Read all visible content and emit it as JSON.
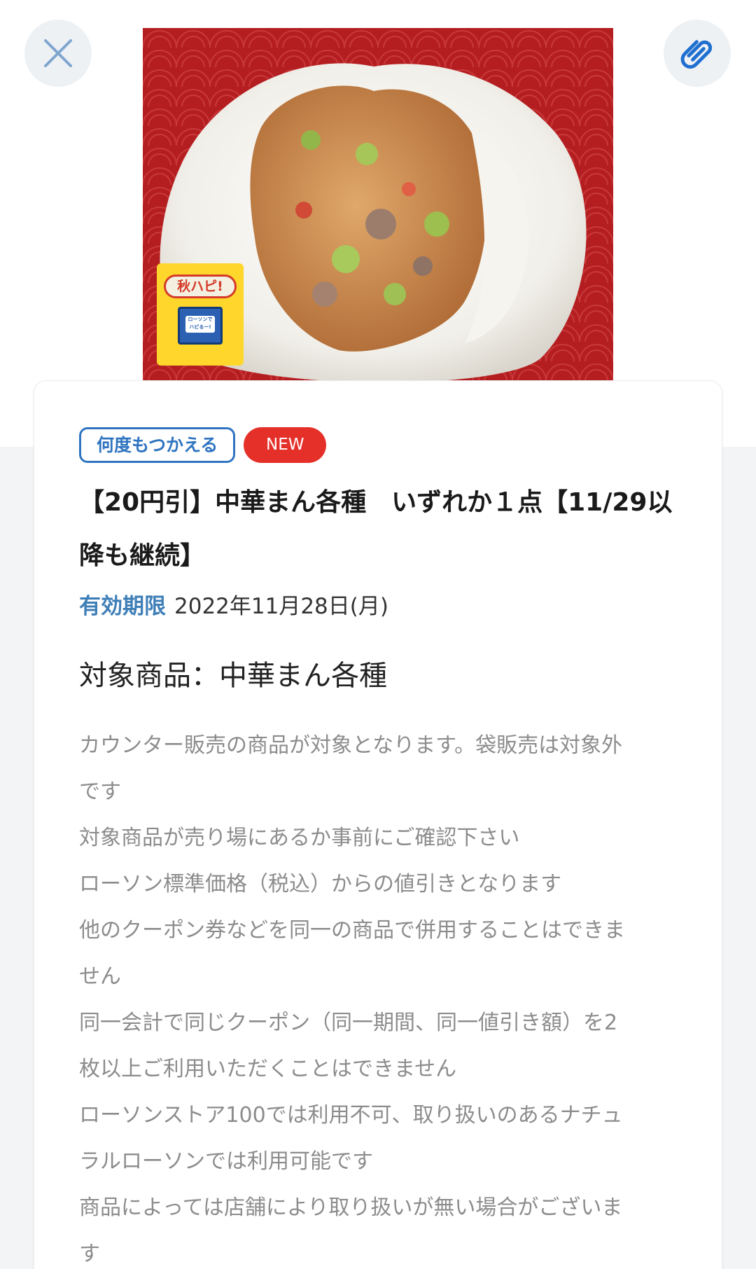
{
  "header": {
    "close_icon": "close-icon",
    "clip_icon": "paperclip-icon"
  },
  "hero": {
    "badge_label": "秋ハピ!",
    "badge_bag_text": "ローソンで ハピるー!"
  },
  "coupon": {
    "tags": {
      "reuse": "何度もつかえる",
      "new": "NEW"
    },
    "title": "【20円引】中華まん各種　いずれか１点【11/29以降も継続】",
    "validity_label": "有効期限",
    "validity_date": "2022年11月28日(月)",
    "target": "対象商品：中華まん各種",
    "notes": [
      "カウンター販売の商品が対象となります。袋販売は対象外です",
      "対象商品が売り場にあるか事前にご確認下さい",
      "ローソン標準価格（税込）からの値引きとなります",
      "他のクーポン券などを同一の商品で併用することはできません",
      "同一会計で同じクーポン（同一期間、同一値引き額）を2枚以上ご利用いただくことはできません",
      "ローソンストア100では利用不可、取り扱いのあるナチュラルローソンでは利用可能です",
      "商品によっては店舗により取り扱いが無い場合がございます"
    ]
  },
  "colors": {
    "accent_blue": "#2f74c0",
    "new_red": "#e5302a",
    "validity_blue": "#3f7fb7"
  }
}
